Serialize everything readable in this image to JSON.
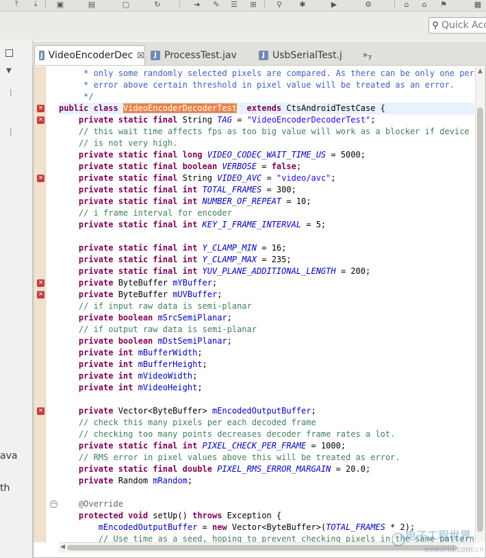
{
  "quick_access": {
    "placeholder": "Quick Access"
  },
  "left_panel": {
    "text_1": "ava",
    "text_2": "th"
  },
  "tabs": [
    {
      "label": "VideoEncoderDec",
      "close": "☒",
      "active": true
    },
    {
      "label": "ProcessTest.jav",
      "active": false
    },
    {
      "label": "UsbSerialTest.j",
      "active": false
    }
  ],
  "tab_overflow": {
    "label": "»",
    "count": "7"
  },
  "code_lines": [
    [
      [
        "cm",
        "     * only some randomly selected pixels are compared. As there can be only one performanc"
      ]
    ],
    [
      [
        "cm",
        "     * error above certain threshold in pixel value will be treated as an error."
      ]
    ],
    [
      [
        "cm",
        "     */"
      ]
    ],
    [
      [
        "kw",
        "public class "
      ],
      [
        "hl",
        "VideoEncoderDecoderTest"
      ],
      [
        "",
        "  "
      ],
      [
        "kw",
        "extends"
      ],
      [
        "",
        " CtsAndroidTestCase {"
      ]
    ],
    [
      [
        "",
        "    "
      ],
      [
        "kw",
        "private static final"
      ],
      [
        "",
        " String "
      ],
      [
        "cs",
        "TAG"
      ],
      [
        "",
        " = "
      ],
      [
        "st",
        "\"VideoEncoderDecoderTest\""
      ],
      [
        "",
        ";"
      ]
    ],
    [
      [
        "lc",
        "    // this wait time affects fps as too big value will work as a blocker if device fps"
      ]
    ],
    [
      [
        "lc",
        "    // is not very high."
      ]
    ],
    [
      [
        "",
        "    "
      ],
      [
        "kw",
        "private static final long "
      ],
      [
        "cs",
        "VIDEO_CODEC_WAIT_TIME_US"
      ],
      [
        "",
        " = 5000;"
      ]
    ],
    [
      [
        "",
        "    "
      ],
      [
        "kw",
        "private static final boolean "
      ],
      [
        "cs",
        "VERBOSE"
      ],
      [
        "",
        " = "
      ],
      [
        "kw",
        "false"
      ],
      [
        "",
        ";"
      ]
    ],
    [
      [
        "",
        "    "
      ],
      [
        "kw",
        "private static final"
      ],
      [
        "",
        " String "
      ],
      [
        "cs",
        "VIDEO_AVC"
      ],
      [
        "",
        " = "
      ],
      [
        "st",
        "\"video/avc\""
      ],
      [
        "",
        ";"
      ]
    ],
    [
      [
        "",
        "    "
      ],
      [
        "kw",
        "private static final int "
      ],
      [
        "cs",
        "TOTAL_FRAMES"
      ],
      [
        "",
        " = 300;"
      ]
    ],
    [
      [
        "",
        "    "
      ],
      [
        "kw",
        "private static final int "
      ],
      [
        "cs",
        "NUMBER_OF_REPEAT"
      ],
      [
        "",
        " = 10;"
      ]
    ],
    [
      [
        "lc",
        "    // i frame interval for encoder"
      ]
    ],
    [
      [
        "",
        "    "
      ],
      [
        "kw",
        "private static final int "
      ],
      [
        "cs",
        "KEY_I_FRAME_INTERVAL"
      ],
      [
        "",
        " = 5;"
      ]
    ],
    [
      [
        "",
        ""
      ]
    ],
    [
      [
        "",
        "    "
      ],
      [
        "kw",
        "private static final int "
      ],
      [
        "cs",
        "Y_CLAMP_MIN"
      ],
      [
        "",
        " = 16;"
      ]
    ],
    [
      [
        "",
        "    "
      ],
      [
        "kw",
        "private static final int "
      ],
      [
        "cs",
        "Y_CLAMP_MAX"
      ],
      [
        "",
        " = 235;"
      ]
    ],
    [
      [
        "",
        "    "
      ],
      [
        "kw",
        "private static final int "
      ],
      [
        "cs",
        "YUV_PLANE_ADDITIONAL_LENGTH"
      ],
      [
        "",
        " = 200;"
      ]
    ],
    [
      [
        "",
        "    "
      ],
      [
        "kw",
        "private"
      ],
      [
        "",
        " ByteBuffer "
      ],
      [
        "fd",
        "mYBuffer"
      ],
      [
        "",
        ";"
      ]
    ],
    [
      [
        "",
        "    "
      ],
      [
        "kw",
        "private"
      ],
      [
        "",
        " ByteBuffer "
      ],
      [
        "fd",
        "mUVBuffer"
      ],
      [
        "",
        ";"
      ]
    ],
    [
      [
        "lc",
        "    // if input raw data is semi-planar"
      ]
    ],
    [
      [
        "",
        "    "
      ],
      [
        "kw",
        "private boolean "
      ],
      [
        "fd",
        "mSrcSemiPlanar"
      ],
      [
        "",
        ";"
      ]
    ],
    [
      [
        "lc",
        "    // if output raw data is semi-planar"
      ]
    ],
    [
      [
        "",
        "    "
      ],
      [
        "kw",
        "private boolean "
      ],
      [
        "fd",
        "mDstSemiPlanar"
      ],
      [
        "",
        ";"
      ]
    ],
    [
      [
        "",
        "    "
      ],
      [
        "kw",
        "private int "
      ],
      [
        "fd",
        "mBufferWidth"
      ],
      [
        "",
        ";"
      ]
    ],
    [
      [
        "",
        "    "
      ],
      [
        "kw",
        "private int "
      ],
      [
        "fd",
        "mBufferHeight"
      ],
      [
        "",
        ";"
      ]
    ],
    [
      [
        "",
        "    "
      ],
      [
        "kw",
        "private int "
      ],
      [
        "fd",
        "mVideoWidth"
      ],
      [
        "",
        ";"
      ]
    ],
    [
      [
        "",
        "    "
      ],
      [
        "kw",
        "private int "
      ],
      [
        "fd",
        "mVideoHeight"
      ],
      [
        "",
        ";"
      ]
    ],
    [
      [
        "",
        ""
      ]
    ],
    [
      [
        "",
        "    "
      ],
      [
        "kw",
        "private"
      ],
      [
        "",
        " Vector<ByteBuffer> "
      ],
      [
        "fd",
        "mEncodedOutputBuffer"
      ],
      [
        "",
        ";"
      ]
    ],
    [
      [
        "lc",
        "    // check this many pixels per each decoded frame"
      ]
    ],
    [
      [
        "lc",
        "    // checking too many points decreases decoder frame rates a lot."
      ]
    ],
    [
      [
        "",
        "    "
      ],
      [
        "kw",
        "private static final int "
      ],
      [
        "cs",
        "PIXEL_CHECK_PER_FRAME"
      ],
      [
        "",
        " = 1000;"
      ]
    ],
    [
      [
        "lc",
        "    // RMS error in pixel values above this will be treated as error."
      ]
    ],
    [
      [
        "",
        "    "
      ],
      [
        "kw",
        "private static final double "
      ],
      [
        "cs",
        "PIXEL_RMS_ERROR_MARGAIN"
      ],
      [
        "",
        " = 20.0;"
      ]
    ],
    [
      [
        "",
        "    "
      ],
      [
        "kw",
        "private"
      ],
      [
        "",
        " Random "
      ],
      [
        "fd",
        "mRandom"
      ],
      [
        "",
        ";"
      ]
    ],
    [
      [
        "",
        ""
      ]
    ],
    [
      [
        "an",
        "    @Override"
      ]
    ],
    [
      [
        "",
        "    "
      ],
      [
        "kw",
        "protected void"
      ],
      [
        "",
        " setUp() "
      ],
      [
        "kw",
        "throws"
      ],
      [
        "",
        " Exception {"
      ]
    ],
    [
      [
        "",
        "        "
      ],
      [
        "fd",
        "mEncodedOutputBuffer"
      ],
      [
        "",
        " = "
      ],
      [
        "kw",
        "new"
      ],
      [
        "",
        " Vector<ByteBuffer>("
      ],
      [
        "cs",
        "TOTAL_FRAMES"
      ],
      [
        "",
        " * 2);"
      ]
    ],
    [
      [
        "lc",
        "        // Use time as a seed, hoping to prevent checking pixels in the same pattern"
      ]
    ]
  ],
  "current_line_index": 3,
  "error_marker_lines": [
    3,
    4,
    9,
    18,
    19,
    29
  ],
  "fold_lines": [
    37
  ],
  "colors": {
    "keyword": "#7f0055",
    "javadoc": "#3f5fbf",
    "line_comment": "#3f7f5f",
    "string": "#2a00ff",
    "field": "#0000c0",
    "highlight": "#e8834a"
  },
  "watermark": {
    "line1": "电子工程世界",
    "line2": "eeworld.com.cn"
  }
}
